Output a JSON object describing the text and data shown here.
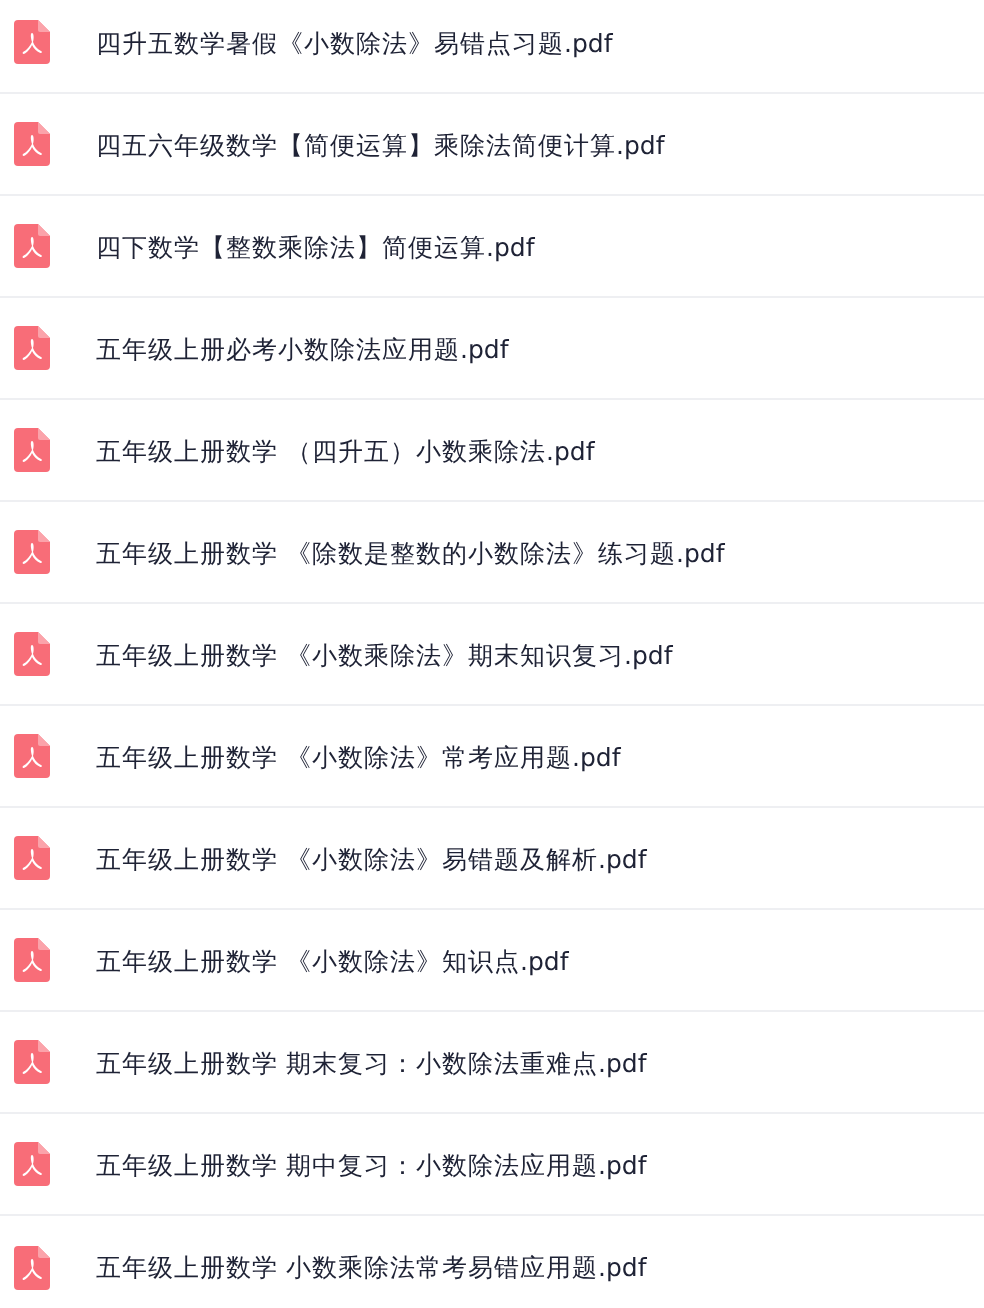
{
  "files": [
    {
      "name": "四升五数学暑假《小数除法》易错点习题.pdf"
    },
    {
      "name": "四五六年级数学【简便运算】乘除法简便计算.pdf"
    },
    {
      "name": "四下数学【整数乘除法】简便运算.pdf"
    },
    {
      "name": "五年级上册必考小数除法应用题.pdf"
    },
    {
      "name": "五年级上册数学 （四升五）小数乘除法.pdf"
    },
    {
      "name": "五年级上册数学 《除数是整数的小数除法》练习题.pdf"
    },
    {
      "name": "五年级上册数学 《小数乘除法》期末知识复习.pdf"
    },
    {
      "name": "五年级上册数学 《小数除法》常考应用题.pdf"
    },
    {
      "name": "五年级上册数学 《小数除法》易错题及解析.pdf"
    },
    {
      "name": "五年级上册数学 《小数除法》知识点.pdf"
    },
    {
      "name": "五年级上册数学 期末复习：小数除法重难点.pdf"
    },
    {
      "name": "五年级上册数学 期中复习：小数除法应用题.pdf"
    },
    {
      "name": "五年级上册数学 小数乘除法常考易错应用题.pdf"
    }
  ]
}
